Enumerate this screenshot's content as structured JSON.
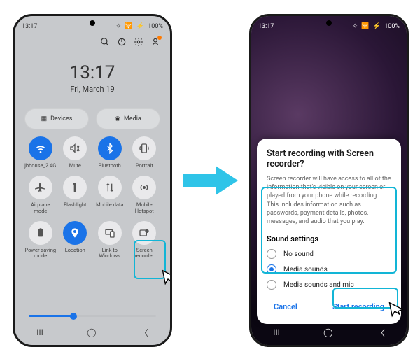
{
  "left": {
    "status": {
      "time": "13:17",
      "battery": "100%"
    },
    "clock": {
      "time": "13:17",
      "date": "Fri, March 19"
    },
    "pills": {
      "devices": "Devices",
      "media": "Media"
    },
    "tiles": [
      {
        "key": "wifi",
        "label": "jbhouse_2.4G",
        "active": true
      },
      {
        "key": "mute",
        "label": "Mute",
        "active": false
      },
      {
        "key": "bluetooth",
        "label": "Bluetooth",
        "active": true
      },
      {
        "key": "portrait",
        "label": "Portrait",
        "active": false
      },
      {
        "key": "airplane",
        "label": "Airplane mode",
        "active": false
      },
      {
        "key": "flashlight",
        "label": "Flashlight",
        "active": false
      },
      {
        "key": "mobiledata",
        "label": "Mobile data",
        "active": false
      },
      {
        "key": "hotspot",
        "label": "Mobile Hotspot",
        "active": false
      },
      {
        "key": "powersave",
        "label": "Power saving mode",
        "active": false
      },
      {
        "key": "location",
        "label": "Location",
        "active": true
      },
      {
        "key": "linkwin",
        "label": "Link to Windows",
        "active": false
      },
      {
        "key": "screenrec",
        "label": "Screen recorder",
        "active": false
      }
    ],
    "nav": {
      "recents": "|||",
      "home": "○",
      "back": "<"
    }
  },
  "right": {
    "status": {
      "time": "13:17",
      "battery": "100%"
    },
    "dialog": {
      "title": "Start recording with Screen recorder?",
      "body": "Screen recorder will have access to all of the information that's visible on your screen or played from your phone while recording. This includes information such as passwords, payment details, photos, messages, and audio that you play.",
      "sound_label": "Sound settings",
      "options": {
        "none": "No sound",
        "media": "Media sounds",
        "mic": "Media sounds and mic"
      },
      "selected": "media",
      "cancel": "Cancel",
      "start": "Start recording"
    }
  }
}
